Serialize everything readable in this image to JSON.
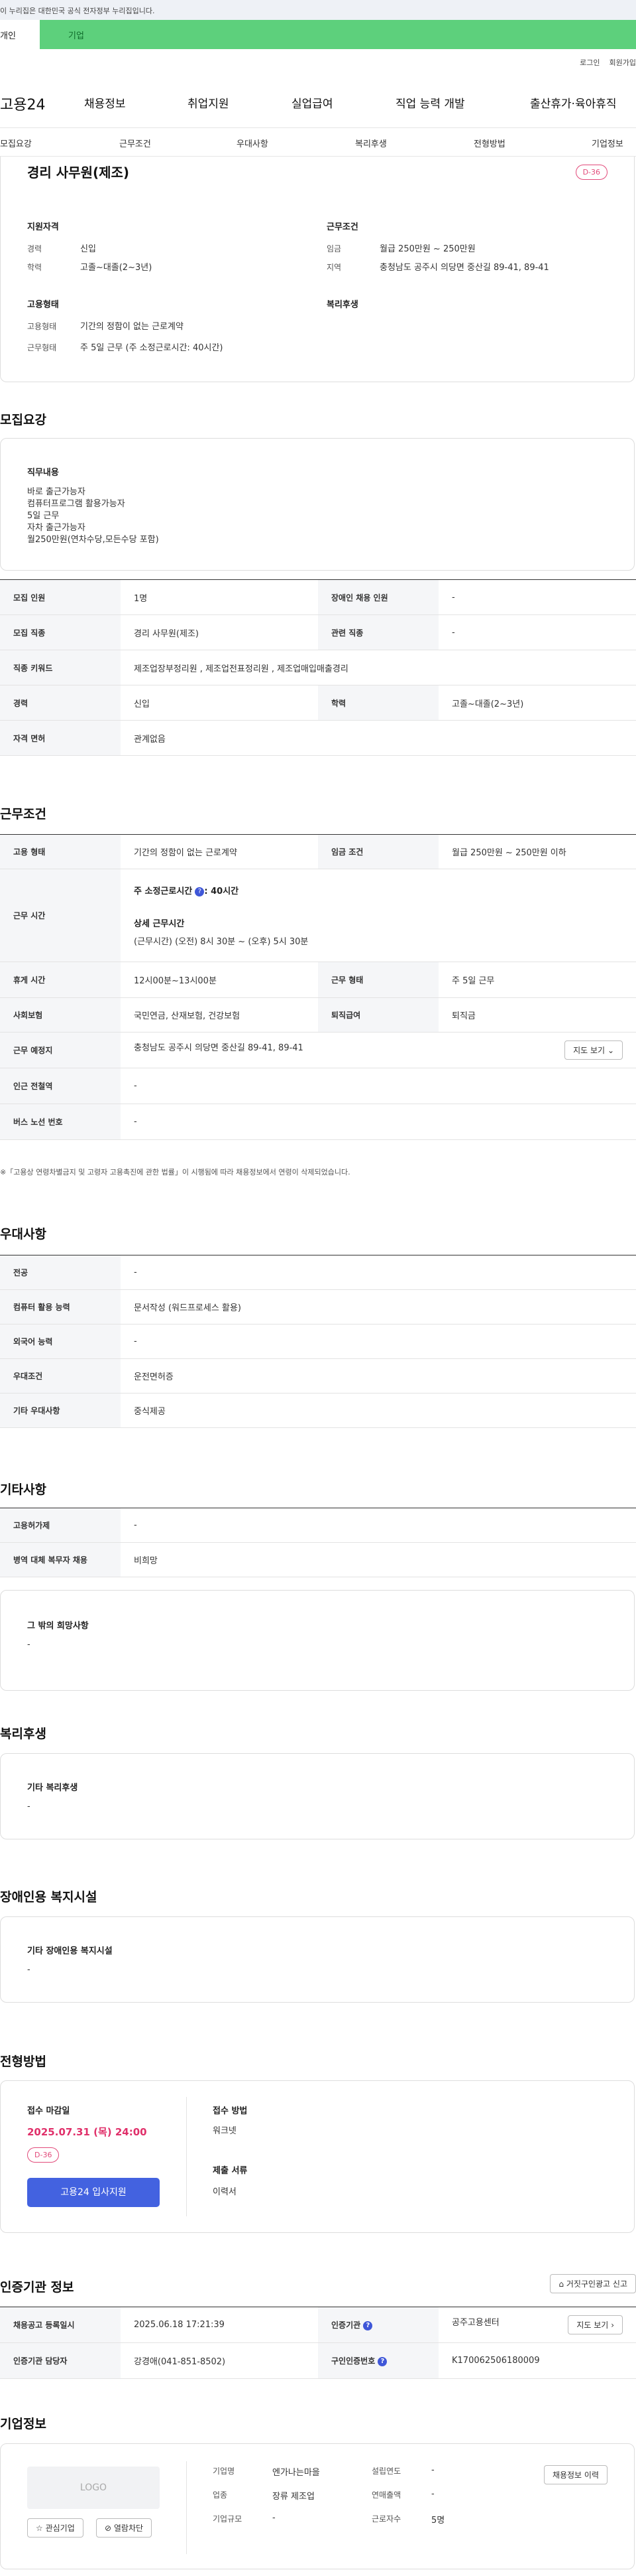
{
  "gov_banner": "이 누리집은 대한민국 공식 전자정부 누리집입니다.",
  "user_tabs": {
    "person": "개인",
    "corp": "기업"
  },
  "util": {
    "login": "로그인",
    "signup": "회원가입"
  },
  "logo": "고용24",
  "gnb": [
    "채용정보",
    "취업지원",
    "실업급여",
    "직업 능력 개발",
    "출산휴가·육아휴직"
  ],
  "snb": [
    "모집요강",
    "근무조건",
    "우대사항",
    "복리후생",
    "전형방법",
    "기업정보"
  ],
  "summary": {
    "title": "경리 사무원(제조)",
    "dday": "D-36",
    "qual_title": "지원자격",
    "qual": [
      {
        "label": "경력",
        "value": "신입"
      },
      {
        "label": "학력",
        "value": "고졸~대졸(2~3년)"
      }
    ],
    "cond_title": "근무조건",
    "cond": [
      {
        "label": "임금",
        "value": "월급 250만원 ~ 250만원"
      },
      {
        "label": "지역",
        "value": "충청남도 공주시 의당면 중산길 89-41, 89-41"
      }
    ],
    "emp_title": "고용형태",
    "emp": [
      {
        "label": "고용형태",
        "value": "기간의 정함이 없는 근로계약"
      },
      {
        "label": "근무형태",
        "value": "주 5일 근무 (주 소정근로시간: 40시간)"
      }
    ],
    "welfare_title": "복리후생"
  },
  "recruit": {
    "section": "모집요강",
    "duty_title": "직무내용",
    "duty_lines": [
      "바로 출근가능자",
      "컴퓨터프로그램 활용가능자",
      "5일 근무",
      "자차 출근가능자",
      "월250만원(연차수당,모든수당 포함)"
    ],
    "rows": [
      {
        "th1": "모집 인원",
        "td1": "1명",
        "th2": "장애인 채용 인원",
        "td2": "-"
      },
      {
        "th1": "모집 직종",
        "td1": "경리 사무원(제조)",
        "th2": "관련 직종",
        "td2": "-"
      },
      {
        "th1": "직종 키워드",
        "td1": "제조업장부정리원 , 제조업전표정리원 , 제조업매입매출경리"
      },
      {
        "th1": "경력",
        "td1": "신입",
        "th2": "학력",
        "td2": "고졸~대졸(2~3년)"
      },
      {
        "th1": "자격 면허",
        "td1": "관계없음"
      }
    ]
  },
  "work": {
    "section": "근무조건",
    "emp_type_th": "고용 형태",
    "emp_type": "기간의 정함이 없는 근로계약",
    "wage_th": "임금 조건",
    "wage": "월급 250만원 ~ 250만원 이하",
    "hours_th": "근무 시간",
    "hours_main": "주 소정근로시간",
    "hours_value": ": 40시간",
    "hours_detail_title": "상세 근무시간",
    "hours_detail": "(근무시간) (오전) 8시 30분 ~ (오후) 5시 30분",
    "break_th": "휴게 시간",
    "break": "12시00분~13시00분",
    "work_type_th": "근무 형태",
    "work_type": "주 5일 근무",
    "insurance_th": "사회보험",
    "insurance": "국민연금, 산재보험, 건강보험",
    "severance_th": "퇴직급여",
    "severance": "퇴직금",
    "place_th": "근무 예정지",
    "place": "충청남도 공주시 의당면 중산길 89-41, 89-41",
    "map_btn": "지도 보기",
    "station_th": "인근 전철역",
    "station": "-",
    "bus_th": "버스 노선 번호",
    "bus": "-",
    "notice": "※「고용상 연령차별금지 및 고령자 고용촉진에 관한 법률」이 시행됨에 따라 채용정보에서 연령이 삭제되었습니다."
  },
  "pref": {
    "section": "우대사항",
    "rows": [
      {
        "th": "전공",
        "td": "-"
      },
      {
        "th": "컴퓨터 활용 능력",
        "td": "문서작성 (워드프로세스 활용)"
      },
      {
        "th": "외국어 능력",
        "td": "-"
      },
      {
        "th": "우대조건",
        "td": "운전면허증"
      },
      {
        "th": "기타 우대사항",
        "td": "중식제공"
      }
    ]
  },
  "etc": {
    "section": "기타사항",
    "rows": [
      {
        "th": "고용허가제",
        "td": "-"
      },
      {
        "th": "병역 대체 복무자 채용",
        "td": "비희망"
      }
    ],
    "hope_title": "그 밖의 희망사항",
    "hope_value": "-"
  },
  "welfare": {
    "section": "복리후생",
    "title": "기타 복리후생",
    "value": "-"
  },
  "disability": {
    "section": "장애인용 복지시설",
    "title": "기타 장애인용 복지시설",
    "value": "-"
  },
  "selection": {
    "section": "전형방법",
    "deadline_title": "접수 마감일",
    "deadline": "2025.07.31 (목) 24:00",
    "dday": "D-36",
    "apply_btn": "고용24 입사지원",
    "method_title": "접수 방법",
    "method": "워크넷",
    "docs_title": "제출 서류",
    "docs": "이력서"
  },
  "agency": {
    "section": "인증기관 정보",
    "report_btn": "거짓구인광고 신고",
    "reg_th": "채용공고 등록일시",
    "reg": "2025.06.18 17:21:39",
    "org_th": "인증기관",
    "org": "공주고용센터",
    "map_btn": "지도 보기",
    "manager_th": "인증기관 담당자",
    "manager": "강경애(041-851-8502)",
    "reqno_th": "구인인증번호",
    "reqno": "K170062506180009"
  },
  "company": {
    "section": "기업정보",
    "logo_text": "LOGO",
    "btn_fav": "관심기업",
    "btn_block": "열람차단",
    "history_btn": "채용정보 이력",
    "rows": [
      {
        "l1": "기업명",
        "v1": "엔가나는마을",
        "l2": "설립연도",
        "v2": "-"
      },
      {
        "l1": "업종",
        "v1": "장류 제조업",
        "l2": "연매출액",
        "v2": "-"
      },
      {
        "l1": "기업규모",
        "v1": "-",
        "l2": "근로자수",
        "v2": "5명"
      }
    ]
  }
}
